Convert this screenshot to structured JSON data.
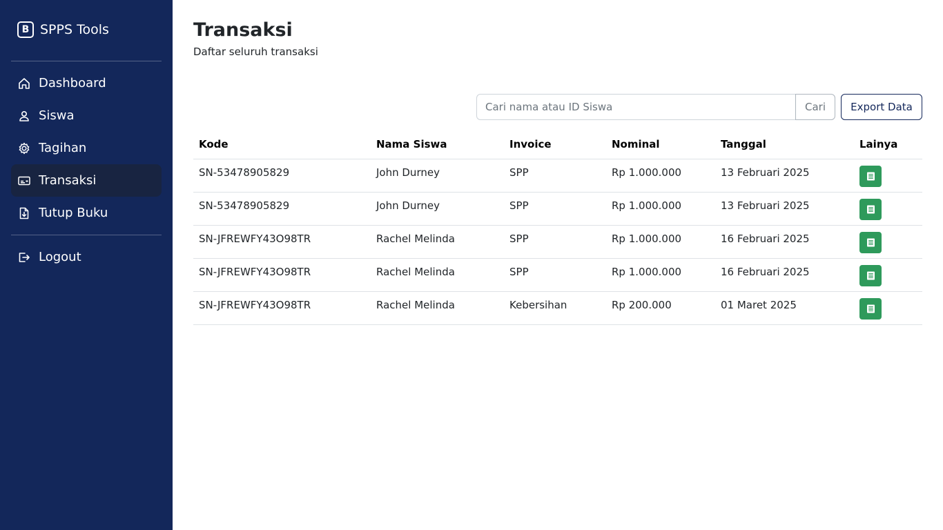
{
  "brand": {
    "mark": "B",
    "name": "SPPS Tools"
  },
  "sidebar": {
    "items": [
      {
        "label": "Dashboard",
        "icon": "home-icon"
      },
      {
        "label": "Siswa",
        "icon": "person-icon"
      },
      {
        "label": "Tagihan",
        "icon": "gear-icon"
      },
      {
        "label": "Transaksi",
        "icon": "credit-card-icon",
        "active": true
      },
      {
        "label": "Tutup Buku",
        "icon": "file-download-icon"
      }
    ],
    "logout": {
      "label": "Logout",
      "icon": "logout-icon"
    }
  },
  "page": {
    "title": "Transaksi",
    "subtitle": "Daftar seluruh transaksi"
  },
  "search": {
    "placeholder": "Cari nama atau ID Siswa",
    "value": "",
    "button": "Cari"
  },
  "export": {
    "label": "Export Data"
  },
  "table": {
    "headers": {
      "kode": "Kode",
      "nama": "Nama Siswa",
      "invoice": "Invoice",
      "nominal": "Nominal",
      "tanggal": "Tanggal",
      "lainya": "Lainya"
    },
    "rows": [
      {
        "kode": "SN-53478905829",
        "nama": "John Durney",
        "invoice": "SPP",
        "nominal": "Rp 1.000.000",
        "tanggal": "13 Februari 2025"
      },
      {
        "kode": "SN-53478905829",
        "nama": "John Durney",
        "invoice": "SPP",
        "nominal": "Rp 1.000.000",
        "tanggal": "13 Februari 2025"
      },
      {
        "kode": "SN-JFREWFY43O98TR",
        "nama": "Rachel Melinda",
        "invoice": "SPP",
        "nominal": "Rp 1.000.000",
        "tanggal": "16 Februari 2025"
      },
      {
        "kode": "SN-JFREWFY43O98TR",
        "nama": "Rachel Melinda",
        "invoice": "SPP",
        "nominal": "Rp 1.000.000",
        "tanggal": "16 Februari 2025"
      },
      {
        "kode": "SN-JFREWFY43O98TR",
        "nama": "Rachel Melinda",
        "invoice": "Kebersihan",
        "nominal": "Rp 200.000",
        "tanggal": "01 Maret 2025"
      }
    ],
    "action_icon": "receipt-icon"
  },
  "colors": {
    "sidebar_bg": "#13275a",
    "active_item_bg": "#182441",
    "action_green": "#2e9a5b",
    "export_border": "#13275a"
  }
}
